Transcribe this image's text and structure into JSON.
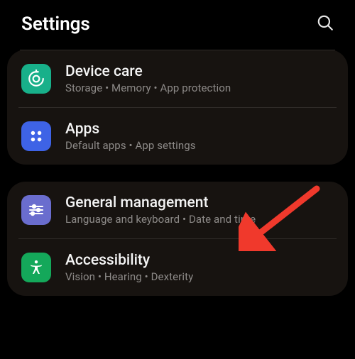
{
  "header": {
    "title": "Settings"
  },
  "icons": {
    "device_care": {
      "bg": "#18b08a"
    },
    "apps": {
      "bg": "#3e63e6"
    },
    "general": {
      "bg": "#6a6dce"
    },
    "accessibility": {
      "bg": "#14a85a"
    }
  },
  "groups": [
    {
      "leading_divider": true,
      "items": [
        {
          "id": "device-care",
          "title": "Device care",
          "subtitle": "Storage  •  Memory  •  App protection",
          "icon": "device-care"
        },
        {
          "id": "apps",
          "title": "Apps",
          "subtitle": "Default apps  •  App settings",
          "icon": "apps"
        }
      ]
    },
    {
      "leading_divider": false,
      "items": [
        {
          "id": "general-management",
          "title": "General management",
          "subtitle": "Language and keyboard  •  Date and time",
          "icon": "general"
        },
        {
          "id": "accessibility",
          "title": "Accessibility",
          "subtitle": "Vision  •  Hearing  •  Dexterity",
          "icon": "accessibility"
        }
      ]
    }
  ],
  "annotation": {
    "arrow_color": "#f0392c",
    "target": "general-management"
  }
}
